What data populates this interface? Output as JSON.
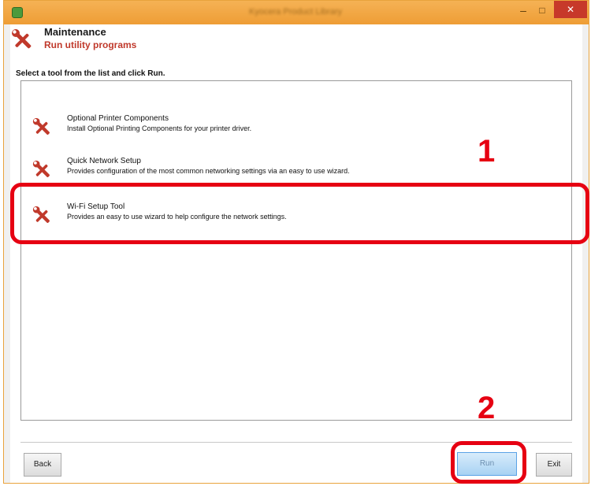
{
  "window": {
    "title": "Kyocera Product Library",
    "controls": {
      "minimize": "–",
      "maximize": "□",
      "close": "✕"
    }
  },
  "header": {
    "icon": "tools-icon",
    "title": "Maintenance",
    "subtitle": "Run utility programs"
  },
  "instruction": "Select a tool from the list and click Run.",
  "tools": [
    {
      "icon": "tools-icon",
      "name": "Optional Printer Components",
      "description": "Install Optional Printing Components for your printer driver."
    },
    {
      "icon": "tools-icon",
      "name": "Quick Network Setup",
      "description": "Provides configuration of the most common networking settings via an easy to use wizard."
    },
    {
      "icon": "tools-icon",
      "name": "Wi-Fi Setup Tool",
      "description": "Provides an easy to use wizard to help configure the network settings."
    }
  ],
  "buttons": {
    "back": "Back",
    "run": "Run",
    "exit": "Exit"
  },
  "callouts": {
    "step1": "1",
    "step2": "2"
  },
  "colors": {
    "accent": "#e60012",
    "titlebar": "#ee9d35",
    "subtitle": "#c0392b"
  }
}
